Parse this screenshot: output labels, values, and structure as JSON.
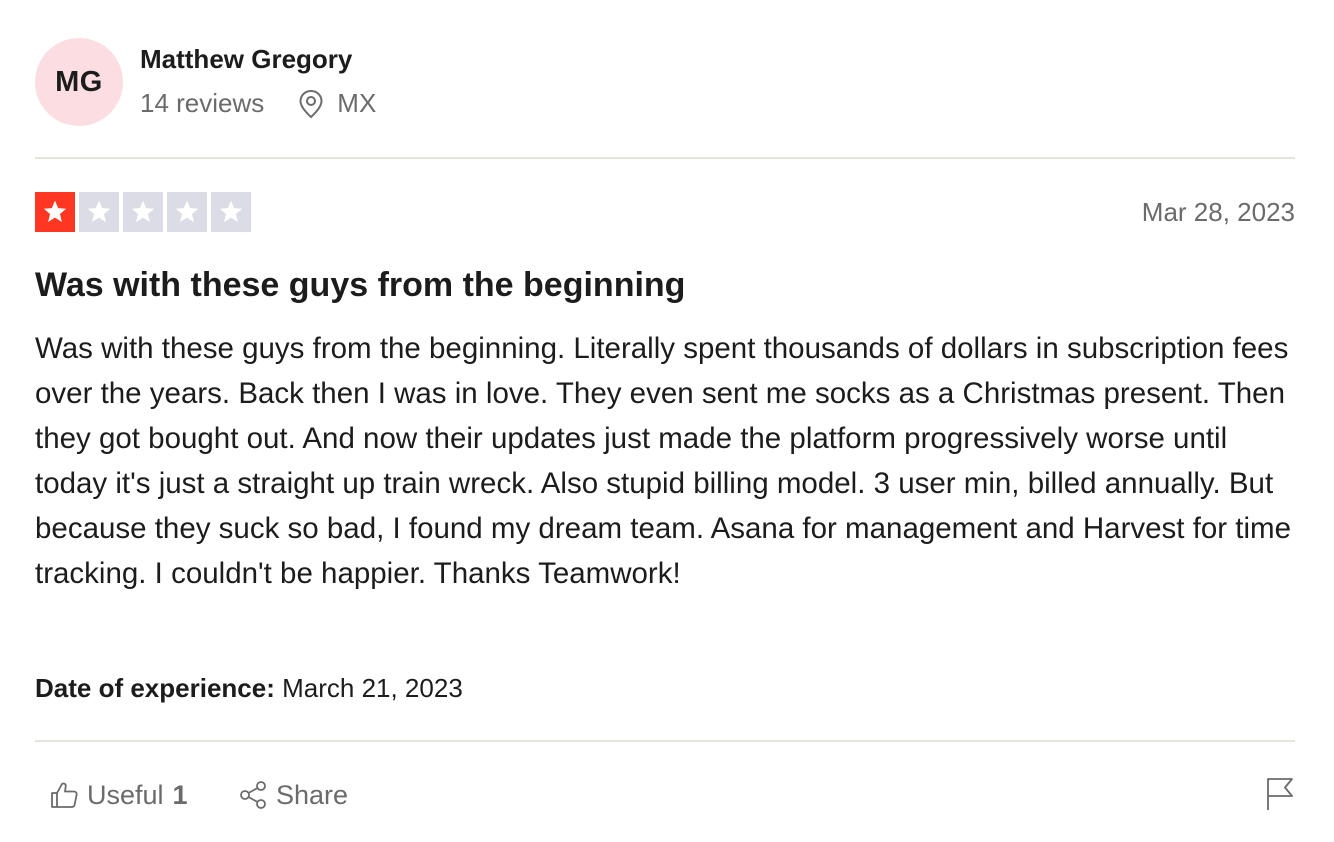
{
  "reviewer": {
    "initials": "MG",
    "name": "Matthew Gregory",
    "reviews_count": "14 reviews",
    "country": "MX",
    "avatar_color": "#fbdde2"
  },
  "review": {
    "rating": 1,
    "max_rating": 5,
    "star_color_on": "#ff3722",
    "star_color_off": "#dcdce6",
    "date": "Mar 28, 2023",
    "title": "Was with these guys from the beginning",
    "body": "Was with these guys from the beginning. Literally spent thousands of dollars in subscription fees over the years. Back then I was in love. They even sent me socks as a Christmas present. Then they got bought out. And now their updates just made the platform progressively worse until today it's just a straight up train wreck. Also stupid billing model. 3 user min, billed annually. But because they suck so bad, I found my dream team. Asana for management and Harvest for time tracking. I couldn't be happier. Thanks Teamwork!",
    "experience_label": "Date of experience:",
    "experience_date": "March 21, 2023"
  },
  "actions": {
    "useful_label": "Useful",
    "useful_count": "1",
    "share_label": "Share",
    "icons": [
      "thumbs-up-icon",
      "share-icon",
      "flag-icon",
      "location-pin-icon",
      "star-icon"
    ]
  }
}
